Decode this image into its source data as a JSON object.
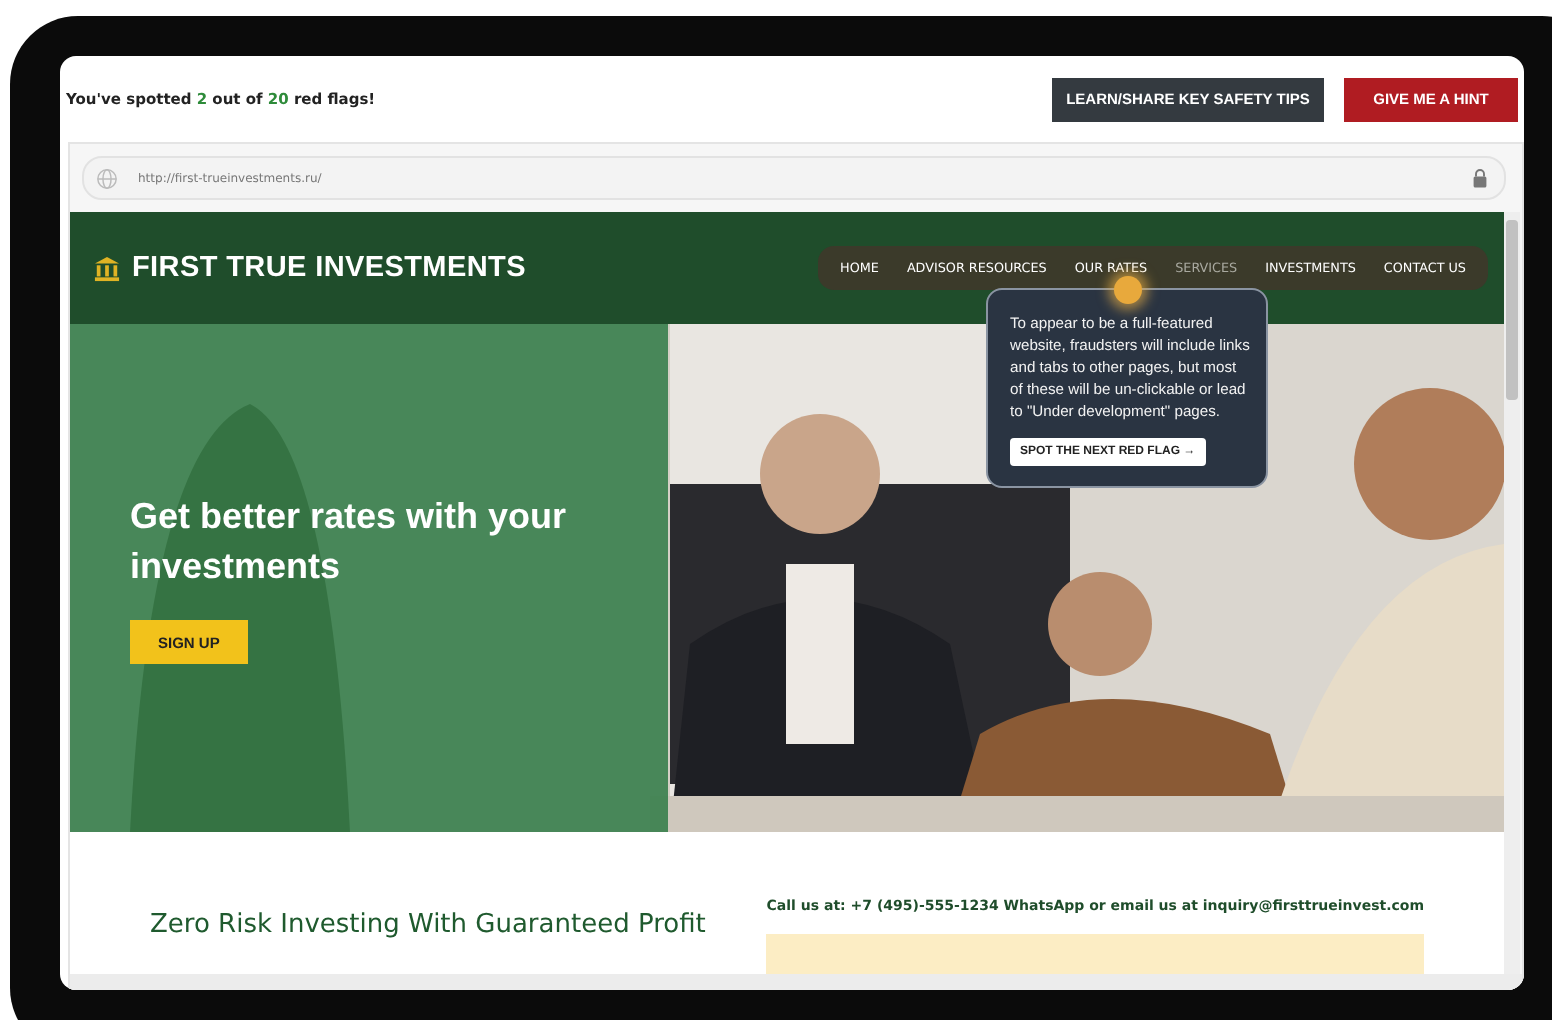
{
  "progress": [
    {
      "text": "You've spotted ",
      "highlight": false
    },
    {
      "text": "2",
      "highlight": true
    },
    {
      "text": " out of ",
      "highlight": false
    },
    {
      "text": "20",
      "highlight": true
    },
    {
      "text": " red flags!",
      "highlight": false
    }
  ],
  "buttons": [
    {
      "label": "LEARN/SHARE KEY SAFETY TIPS",
      "kind": "dark"
    },
    {
      "label": "GIVE ME A HINT",
      "kind": "red"
    }
  ],
  "browser": {
    "url": "http://first-trueinvestments.ru/"
  },
  "site": {
    "logo": "FIRST TRUE INVESTMENTS",
    "nav": [
      {
        "label": "HOME",
        "highlighted": false
      },
      {
        "label": "ADVISOR RESOURCES",
        "highlighted": false
      },
      {
        "label": "OUR RATES",
        "highlighted": false
      },
      {
        "label": "SERVICES",
        "highlighted": true
      },
      {
        "label": "INVESTMENTS",
        "highlighted": false
      },
      {
        "label": "CONTACT US",
        "highlighted": false
      }
    ],
    "hero": {
      "heading": "Get better rates with your investments",
      "button": "SIGN UP"
    },
    "heading": "Zero Risk Investing With Guaranteed Profit",
    "contact": "Call us at: +7 (495)-555-1234 WhatsApp or email us at inquiry@firsttrueinvest.com"
  },
  "tooltip": {
    "text": "To appear to be a full-featured website, fraudsters will include links and tabs to other pages, but most of these will be un-clickable or lead to \"Under development\" pages.",
    "button": "SPOT THE NEXT RED FLAG",
    "arrow": "→"
  }
}
